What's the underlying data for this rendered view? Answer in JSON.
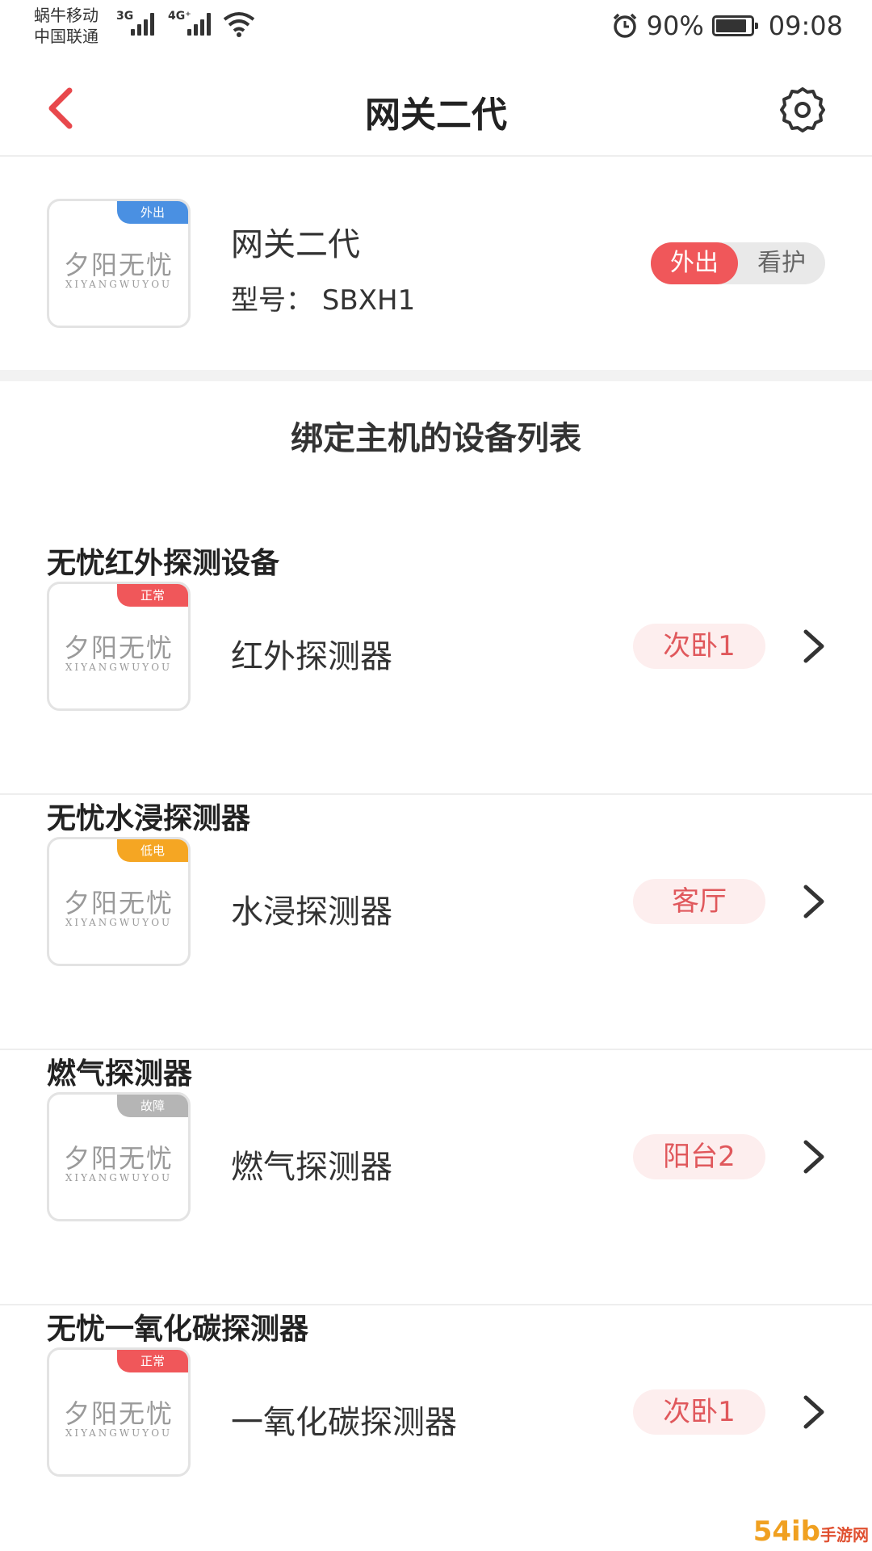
{
  "status_bar": {
    "carrier1": "蜗牛移动",
    "carrier2": "中国联通",
    "net1": "3G",
    "net2": "4G⁺",
    "battery_pct": "90%",
    "time": "09:08",
    "icons": [
      "signal-icon",
      "wifi-icon",
      "alarm-icon",
      "battery-icon"
    ]
  },
  "nav": {
    "title": "网关二代",
    "back_icon": "back-chevron-icon",
    "settings_icon": "gear-icon"
  },
  "gateway": {
    "badge": "外出",
    "badge_color": "#4a90e2",
    "logo_cn": "夕阳无忧",
    "logo_en": "XIYANGWUYOU",
    "name": "网关二代",
    "model": "型号： SBXH1",
    "mode_options": [
      "外出",
      "看护"
    ],
    "mode_selected": "外出"
  },
  "section_title": "绑定主机的设备列表",
  "groups": [
    {
      "title": "无忧红外探测设备",
      "badge": "正常",
      "badge_color": "#f0575a",
      "device": "红外探测器",
      "room": "次卧1"
    },
    {
      "title": "无忧水浸探测器",
      "badge": "低电",
      "badge_color": "#f5a623",
      "device": "水浸探测器",
      "room": "客厅"
    },
    {
      "title": "燃气探测器",
      "badge": "故障",
      "badge_color": "#b5b5b5",
      "device": "燃气探测器",
      "room": "阳台2"
    },
    {
      "title": "无忧一氧化碳探测器",
      "badge": "正常",
      "badge_color": "#f0575a",
      "device": "一氧化碳探测器",
      "room": "次卧1"
    }
  ],
  "watermark": {
    "brand": "54ib",
    "sub": "手游网"
  },
  "colors": {
    "accent": "#f0575a",
    "room_bg": "#fdeeee"
  }
}
